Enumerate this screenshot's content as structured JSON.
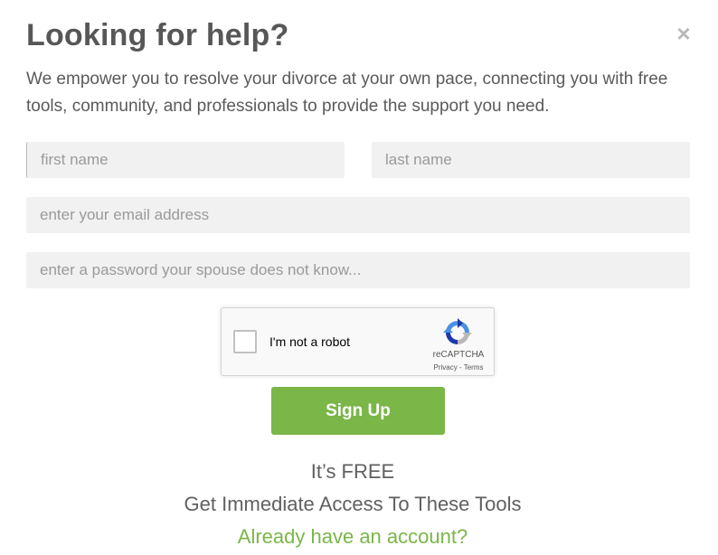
{
  "modal": {
    "title": "Looking for help?",
    "close_label": "×",
    "intro": "We empower you to resolve your divorce at your own pace, connecting you with free tools, community, and professionals to provide the support you need."
  },
  "form": {
    "first_name_placeholder": "first name",
    "first_name_value": "",
    "last_name_placeholder": "last name",
    "last_name_value": "",
    "email_placeholder": "enter your email address",
    "email_value": "",
    "password_placeholder": "enter a password your spouse does not know...",
    "password_value": ""
  },
  "recaptcha": {
    "label": "I'm not a robot",
    "brand": "reCAPTCHA",
    "privacy": "Privacy",
    "separator": " - ",
    "terms": "Terms",
    "checked": false
  },
  "signup_button": "Sign Up",
  "footer": {
    "free_text": "It’s FREE",
    "tools_text": "Get Immediate Access To These Tools",
    "login_link": "Already have an account?"
  },
  "colors": {
    "accent_green": "#7ab648",
    "field_bg": "#f1f1f1",
    "text_gray": "#575757"
  },
  "icons": {
    "close": "close-icon",
    "recaptcha": "recaptcha-logo-icon"
  }
}
